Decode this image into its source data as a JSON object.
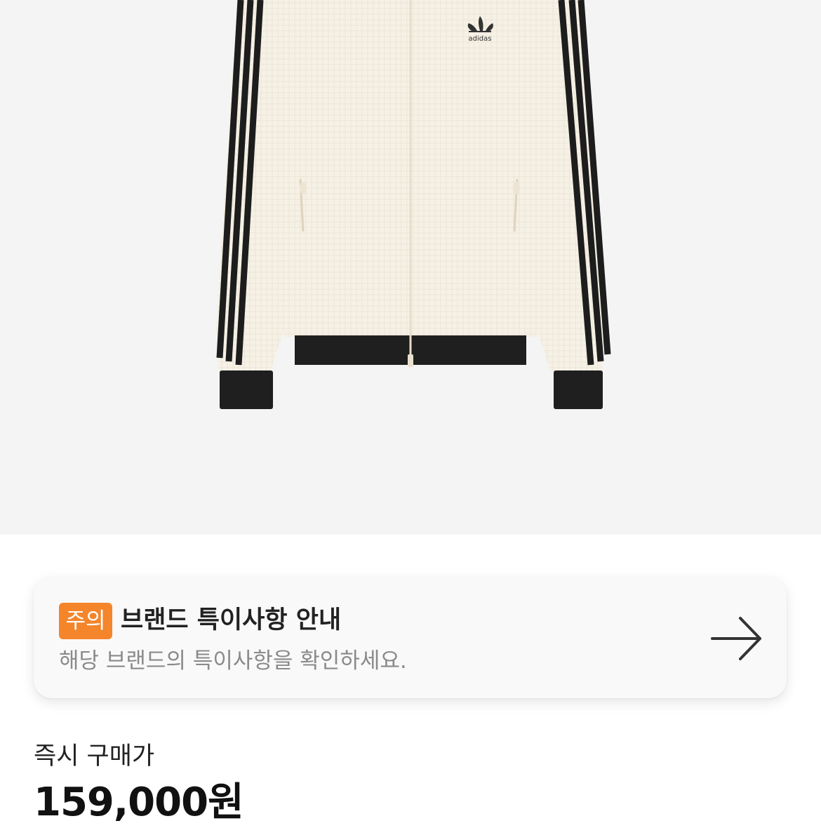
{
  "product": {
    "image_alt": "adidas track jacket",
    "logo_text": "adidas"
  },
  "notice": {
    "badge_label": "주의",
    "title": "브랜드 특이사항 안내",
    "subtitle": "해당 브랜드의 특이사항을 확인하세요.",
    "arrow_icon": "arrow-right-icon",
    "badge_color": "#f4852b"
  },
  "price": {
    "label": "즉시 구매가",
    "value": "159,000원"
  }
}
